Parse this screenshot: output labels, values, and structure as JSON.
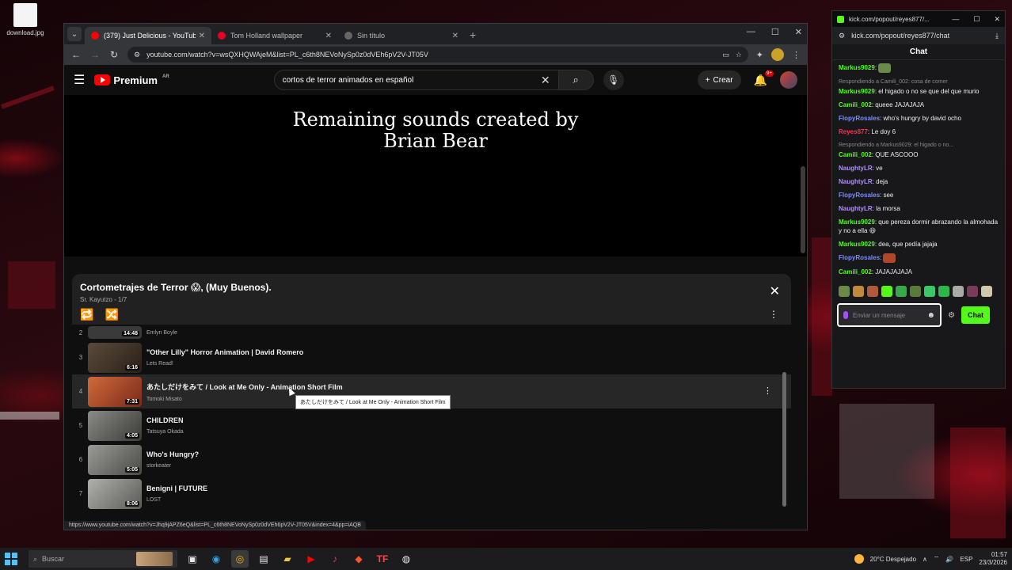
{
  "desktop": {
    "icon_label": "download.jpg"
  },
  "chrome": {
    "tabs": [
      {
        "title": "(379) Just Delicious - YouTube",
        "active": true,
        "favicon_color": "#ff0000"
      },
      {
        "title": "Tom Holland wallpaper",
        "active": false,
        "favicon_color": "#e60023"
      },
      {
        "title": "Sin título",
        "active": false,
        "favicon_color": "#888888"
      }
    ],
    "url": "youtube.com/watch?v=wsQXHQWAjeM&list=PL_c6th8NEVoNySp0z0dVEh6pV2V-JT05V",
    "status_url": "https://www.youtube.com/watch?v=Jhq9jAPZ6eQ&list=PL_c6th8NEVoNySp0z0dVEh6pV2V-JT05V&index=4&pp=iAQB"
  },
  "youtube": {
    "logo_text": "Premium",
    "logo_sup": "AR",
    "search_query": "cortos de terror animados en español",
    "create_label": "Crear",
    "notif_count": "9+",
    "video_caption_line1": "Remaining sounds created by",
    "video_caption_line2": "Brian Bear"
  },
  "playlist": {
    "title": "Cortometrajes de Terror 😱, (Muy Buenos).",
    "subtitle": "Sr. Kayutzo - 1/7",
    "items": [
      {
        "index": "2",
        "title": "",
        "channel": "Emlyn Boyle",
        "duration": "14:48",
        "thumb": "#3a3a3a"
      },
      {
        "index": "3",
        "title": "\"Other Lilly\" Horror Animation | David Romero",
        "channel": "Lets Read!",
        "duration": "6:16",
        "thumb": "#5a4a3a"
      },
      {
        "index": "4",
        "title": "あたしだけをみて / Look at Me Only - Animation Short Film",
        "channel": "Tomoki Misato",
        "duration": "7:31",
        "thumb": "#b0472a"
      },
      {
        "index": "5",
        "title": "CHILDREN",
        "channel": "Tatsuya Okada",
        "duration": "4:05",
        "thumb": "#6a6a66"
      },
      {
        "index": "6",
        "title": "Who's Hungry?",
        "channel": "storkeater",
        "duration": "5:05",
        "thumb": "#7a7a76"
      },
      {
        "index": "7",
        "title": "Benigni | FUTURE",
        "channel": "LOST",
        "duration": "8:06",
        "thumb": "#8a8a86"
      }
    ],
    "tooltip": "あたしだけをみて / Look at Me Only - Animation Short Film"
  },
  "kick": {
    "window_title": "kick.com/popout/reyes877/...",
    "address": "kick.com/popout/reyes877/chat",
    "chat_title": "Chat",
    "messages": [
      {
        "reply": "",
        "user": "Markus9029",
        "color": "#53fc18",
        "text": ""
      },
      {
        "reply": "Respondiendo a Camili_002: cosa de comer",
        "user": "Markus9029",
        "color": "#53fc18",
        "text": "el higado o no se que del que murio"
      },
      {
        "reply": "",
        "user": "Camili_002",
        "color": "#53fc18",
        "text": "queee JAJAJAJA"
      },
      {
        "reply": "",
        "user": "FlopyRosales",
        "color": "#7b8cff",
        "text": "who's hungry by david ocho"
      },
      {
        "reply": "",
        "user": "Reyes877",
        "color": "#ff2d55",
        "text": "Le doy 6"
      },
      {
        "reply": "Respondiendo a Markus9029: el higado o no...",
        "user": "Camili_002",
        "color": "#53fc18",
        "text": "QUE ASCOOO"
      },
      {
        "reply": "",
        "user": "NaughtyLR",
        "color": "#b48cff",
        "text": "ve"
      },
      {
        "reply": "",
        "user": "NaughtyLR",
        "color": "#b48cff",
        "text": "deja"
      },
      {
        "reply": "",
        "user": "FlopyRosales",
        "color": "#7b8cff",
        "text": "see"
      },
      {
        "reply": "",
        "user": "NaughtyLR",
        "color": "#b48cff",
        "text": "la morsa"
      },
      {
        "reply": "",
        "user": "Markus9029",
        "color": "#53fc18",
        "text": "que pereza dormir abrazando la almohada y no a ella 😆"
      },
      {
        "reply": "",
        "user": "Markus9029",
        "color": "#53fc18",
        "text": "dea, que pedía jajaja"
      },
      {
        "reply": "",
        "user": "FlopyRosales",
        "color": "#7b8cff",
        "text": ""
      },
      {
        "reply": "",
        "user": "Camili_002",
        "color": "#53fc18",
        "text": "JAJAJAJAJA"
      }
    ],
    "input_placeholder": "Enviar un mensaje",
    "chat_button": "Chat"
  },
  "taskbar": {
    "search_placeholder": "Buscar",
    "weather": "20°C Despejado",
    "lang": "ESP",
    "time": "01:57",
    "date": "23/3/2026"
  },
  "colors": {
    "youtube_red": "#ff0000",
    "kick_green": "#53fc18",
    "windows_blue": "#4cc2ff"
  }
}
